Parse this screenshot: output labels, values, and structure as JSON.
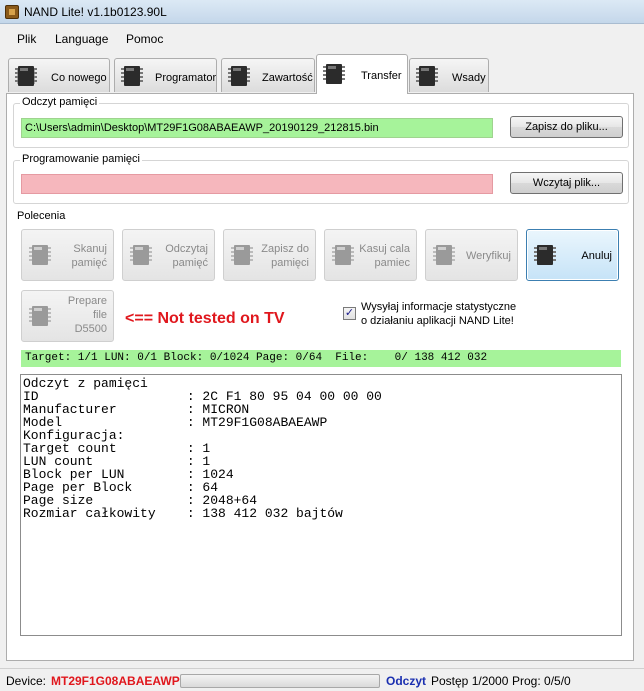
{
  "window": {
    "title": "NAND Lite! v1.1b0123.90L"
  },
  "menu": [
    "Plik",
    "Language",
    "Pomoc"
  ],
  "tabs": [
    {
      "label": "Co nowego",
      "active": false
    },
    {
      "label": "Programator",
      "active": false
    },
    {
      "label": "Zawartość",
      "active": false
    },
    {
      "label": "Transfer",
      "active": true
    },
    {
      "label": "Wsady",
      "active": false
    }
  ],
  "read_group": {
    "title": "Odczyt pamięci",
    "path": "C:\\Users\\admin\\Desktop\\MT29F1G08ABAEAWP_20190129_212815.bin",
    "button": "Zapisz do pliku..."
  },
  "program_group": {
    "title": "Programowanie pamięci",
    "path": "",
    "button": "Wczytaj plik..."
  },
  "commands": {
    "title": "Polecenia",
    "buttons": [
      {
        "label": "Skanuj\npamięć",
        "enabled": false
      },
      {
        "label": "Odczytaj\npamięć",
        "enabled": false
      },
      {
        "label": "Zapisz do\npamięci",
        "enabled": false
      },
      {
        "label": "Kasuj cala\npamiec",
        "enabled": false
      },
      {
        "label": "Weryfikuj",
        "enabled": false
      },
      {
        "label": "Anuluj",
        "enabled": true
      }
    ],
    "prepare": {
      "label": "Prepare\nfile\nD5500",
      "enabled": false
    },
    "warning": "<== Not tested on TV",
    "stats_checkbox": {
      "checked": true,
      "label": "Wysyłaj informacje statystyczne\no działaniu aplikacji NAND Lite!"
    }
  },
  "status_line": "Target: 1/1 LUN: 0/1 Block: 0/1024 Page: 0/64  File:    0/ 138 412 032",
  "console": [
    "Odczyt z pamięci",
    "ID                   : 2C F1 80 95 04 00 00 00",
    "Manufacturer         : MICRON",
    "Model                : MT29F1G08ABAEAWP",
    "Konfiguracja:",
    "Target count         : 1",
    "LUN count            : 1",
    "Block per LUN        : 1024",
    "Page per Block       : 64",
    "Page size            : 2048+64",
    "Rozmiar całkowity    : 138 412 032 bajtów"
  ],
  "statusbar": {
    "device_label": "Device:",
    "device_value": "MT29F1G08ABAEAWP",
    "progress_fraction": 0.0,
    "mode": "Odczyt",
    "progress_text": "Postęp 1/2000",
    "prog_text": "Prog: 0/5/0"
  },
  "colors": {
    "green_field": "#a6f39a",
    "pink_field": "#f6b7bd",
    "warning_text": "#e0171d",
    "device_text": "#e0171d",
    "mode_text": "#1a2fb0"
  }
}
